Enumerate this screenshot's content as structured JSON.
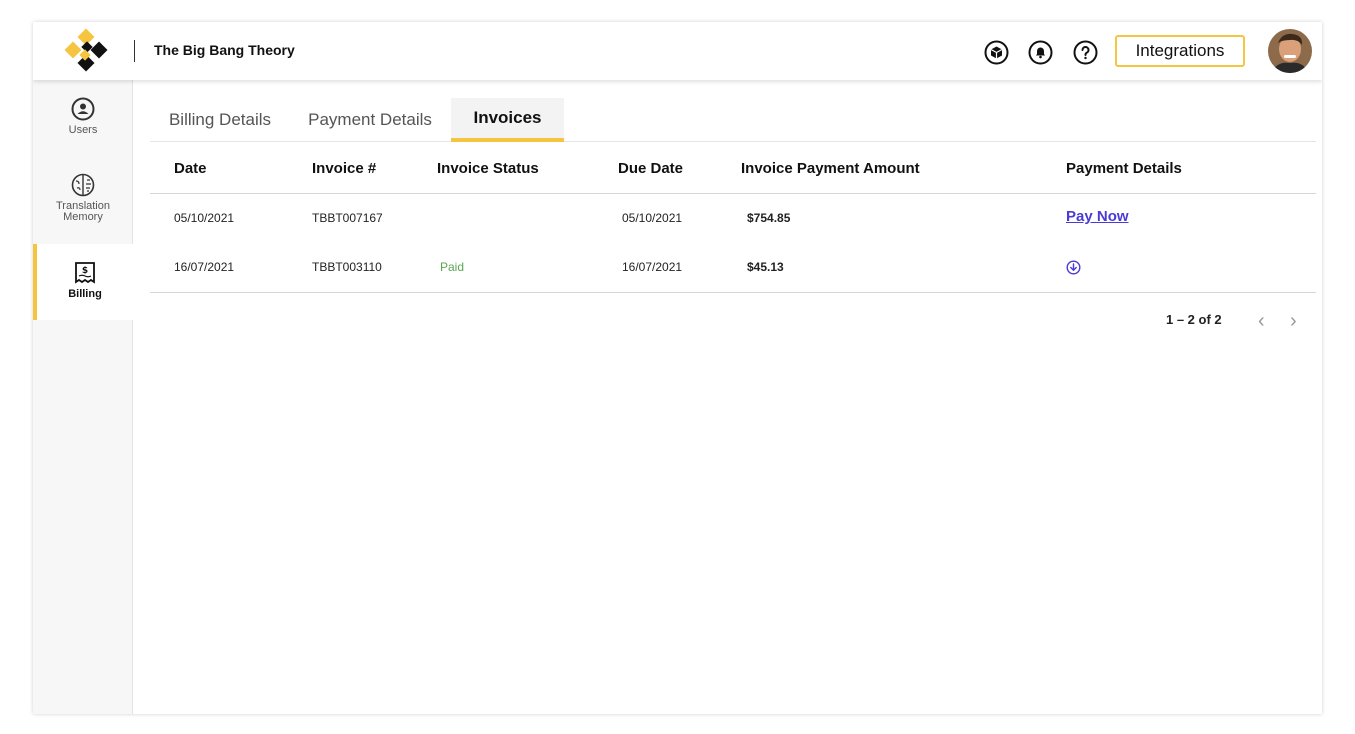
{
  "header": {
    "project_name": "The Big Bang Theory",
    "integrations_label": "Integrations",
    "icons": [
      "cube-icon",
      "bell-icon",
      "help-icon"
    ],
    "accent": "#f5c542"
  },
  "sidebar": {
    "items": [
      {
        "label": "Users",
        "icon": "user-icon",
        "active": false
      },
      {
        "label": "Translation Memory",
        "icon": "brain-icon",
        "active": false
      },
      {
        "label": "Billing",
        "icon": "receipt-icon",
        "active": true
      }
    ]
  },
  "tabs": [
    {
      "label": "Billing Details",
      "active": false
    },
    {
      "label": "Payment Details",
      "active": false
    },
    {
      "label": "Invoices",
      "active": true
    }
  ],
  "table": {
    "columns": [
      "Date",
      "Invoice #",
      "Invoice Status",
      "Due Date",
      "Invoice Payment Amount",
      "Payment Details"
    ],
    "rows": [
      {
        "date": "05/10/2021",
        "invoice": "TBBT007167",
        "status": "",
        "due": "05/10/2021",
        "amount": "$754.85",
        "payment": "Pay Now"
      },
      {
        "date": "16/07/2021",
        "invoice": "TBBT003110",
        "status": "Paid",
        "due": "16/07/2021",
        "amount": "$45.13",
        "payment": "download-icon"
      }
    ]
  },
  "pagination": {
    "text": "1 – 2 of 2"
  }
}
